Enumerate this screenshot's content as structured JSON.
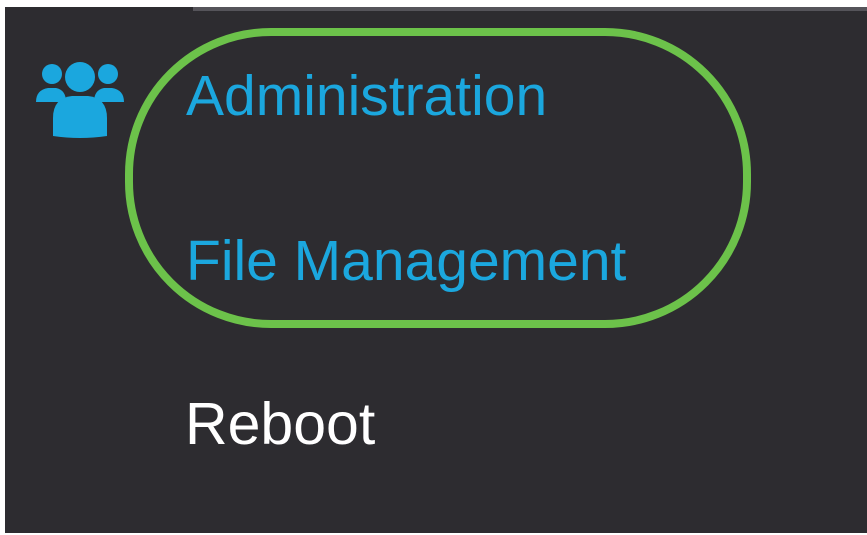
{
  "sidebar": {
    "section_icon": "users-icon",
    "items": [
      {
        "label": "Administration",
        "state": "section-header"
      },
      {
        "label": "File Management",
        "state": "highlighted"
      },
      {
        "label": "Reboot",
        "state": "normal"
      }
    ]
  },
  "colors": {
    "background": "#2d2c30",
    "accent": "#1ba7de",
    "highlight_ring": "#6cc24a",
    "text": "#ffffff"
  }
}
